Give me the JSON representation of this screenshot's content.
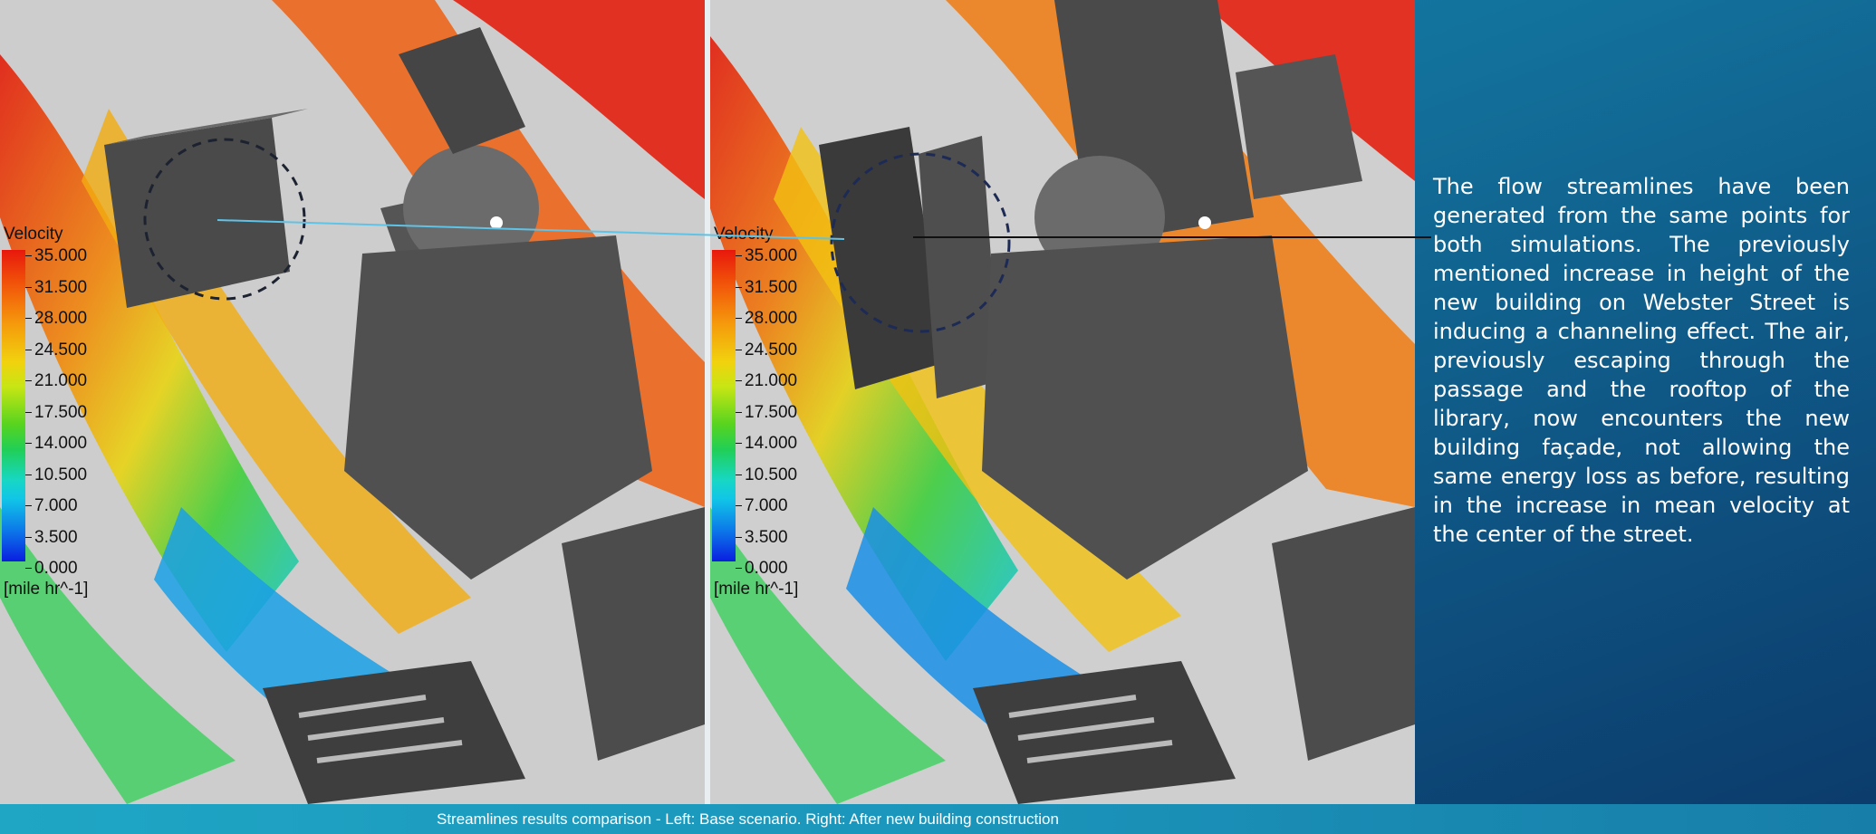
{
  "slide": {
    "description": "The flow streamlines have been generated from the same points for both simulations. The previously mentioned increase in height of the new building on Webster Street is inducing a channeling effect. The air, previously escaping through the passage and the rooftop of the library, now encounters the new building façade, not allowing the same energy loss as before, resulting in the increase in mean velocity at the center of the street.",
    "caption": "Streamlines results comparison - Left: Base scenario. Right: After new building construction"
  },
  "panels": [
    {
      "name": "base-scenario",
      "legend": {
        "title": "Velocity",
        "ticks": [
          "35.000",
          "31.500",
          "28.000",
          "24.500",
          "21.000",
          "17.500",
          "14.000",
          "10.500",
          "7.000",
          "3.500",
          "0.000"
        ],
        "unit": "[mile hr^-1]"
      }
    },
    {
      "name": "new-building-scenario",
      "legend": {
        "title": "Velocity",
        "ticks": [
          "35.000",
          "31.500",
          "28.000",
          "24.500",
          "21.000",
          "17.500",
          "14.000",
          "10.500",
          "7.000",
          "3.500",
          "0.000"
        ],
        "unit": "[mile hr^-1]"
      }
    }
  ],
  "colors": {
    "background_start": "#1690b4",
    "background_end": "#0b3a6a",
    "caption_bar": "#1b95bb",
    "text": "#ffffff",
    "velocity_max": "#e8180c",
    "velocity_min": "#0a1ee0"
  }
}
